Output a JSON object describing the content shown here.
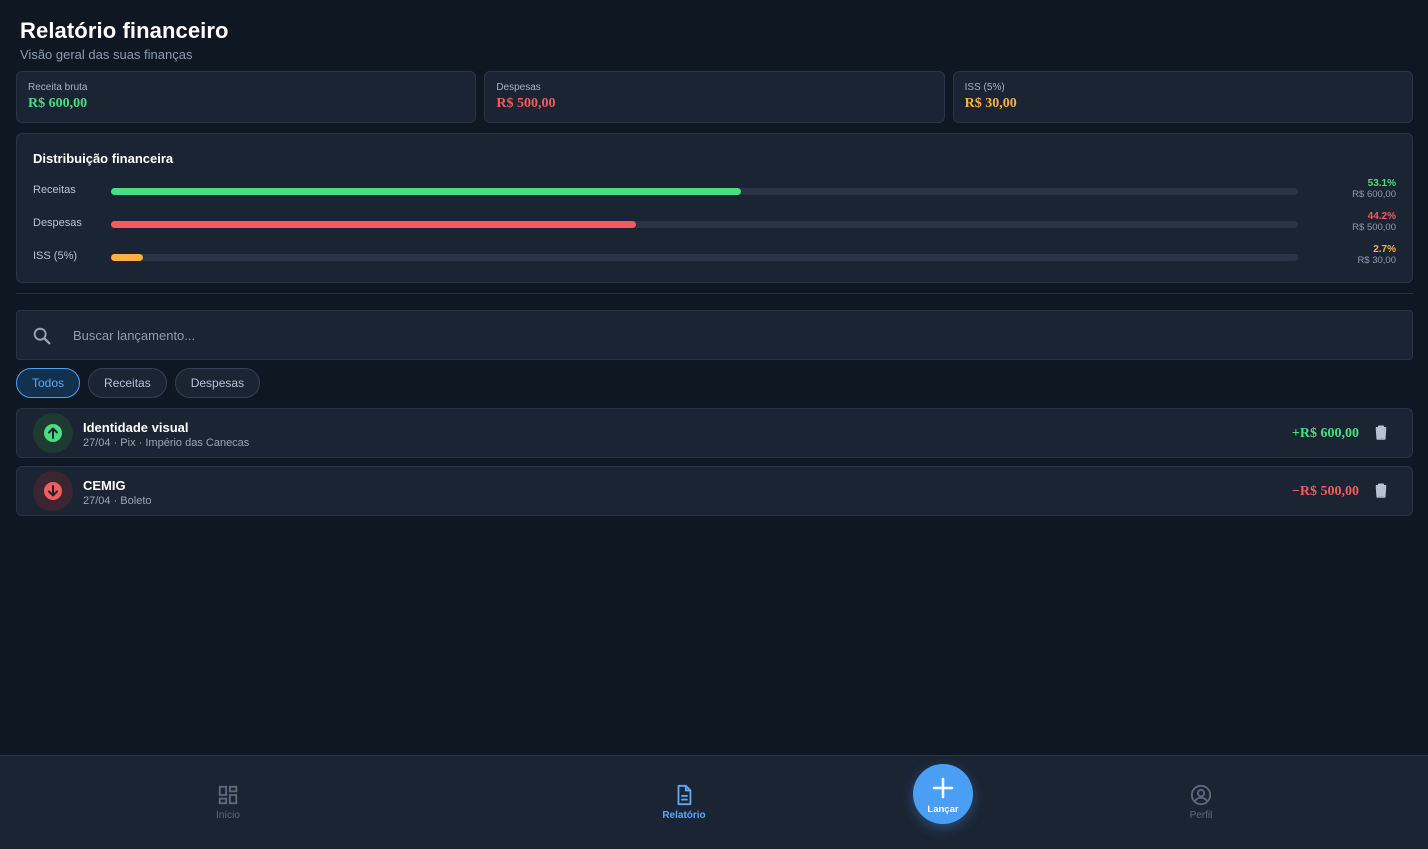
{
  "header": {
    "title": "Relatório financeiro",
    "subtitle": "Visão geral das suas finanças"
  },
  "summary_cards": [
    {
      "label": "Receita bruta",
      "value": "R$ 600,00",
      "color": "#4ade80"
    },
    {
      "label": "Despesas",
      "value": "R$ 500,00",
      "color": "#f25c5c"
    },
    {
      "label": "ISS (5%)",
      "value": "R$ 30,00",
      "color": "#fbb040"
    }
  ],
  "distribution": {
    "title": "Distribuição financeira",
    "rows": [
      {
        "label": "Receitas",
        "percent_text": "53.1%",
        "amount": "R$ 600,00",
        "fill_percent": 53.1,
        "color": "#4ade80"
      },
      {
        "label": "Despesas",
        "percent_text": "44.2%",
        "amount": "R$ 500,00",
        "fill_percent": 44.2,
        "color": "#f25c5c"
      },
      {
        "label": "ISS (5%)",
        "percent_text": "2.7%",
        "amount": "R$ 30,00",
        "fill_percent": 2.7,
        "color": "#fbb040"
      }
    ]
  },
  "search": {
    "placeholder": "Buscar lançamento...",
    "value": "",
    "icon": "search-icon"
  },
  "filters": {
    "options": [
      "Todos",
      "Receitas",
      "Despesas"
    ],
    "selected": "Todos"
  },
  "transactions": [
    {
      "title": "Identidade visual",
      "meta": "27/04 · Pix · Império das Canecas",
      "amount": "+R$ 600,00",
      "type": "income",
      "icon": "arrow-up-icon",
      "color": "#4ade80"
    },
    {
      "title": "CEMIG",
      "meta": "27/04 · Boleto",
      "amount": "−R$ 500,00",
      "type": "expense",
      "icon": "arrow-down-icon",
      "color": "#f25c5c"
    }
  ],
  "bottom_nav": {
    "items": [
      {
        "label": "Início",
        "icon": "dashboard-icon"
      },
      {
        "label": "Relatório",
        "icon": "document-icon",
        "active": true
      },
      {
        "label": "Perfil",
        "icon": "user-circle-icon"
      }
    ],
    "fab_label": "Lançar",
    "fab_icon": "plus-icon"
  },
  "colors": {
    "background": "#0f1722",
    "surface": "#1b2433",
    "accent": "#4a9ff5",
    "income": "#4ade80",
    "expense": "#f25c5c",
    "tax": "#fbb040"
  }
}
